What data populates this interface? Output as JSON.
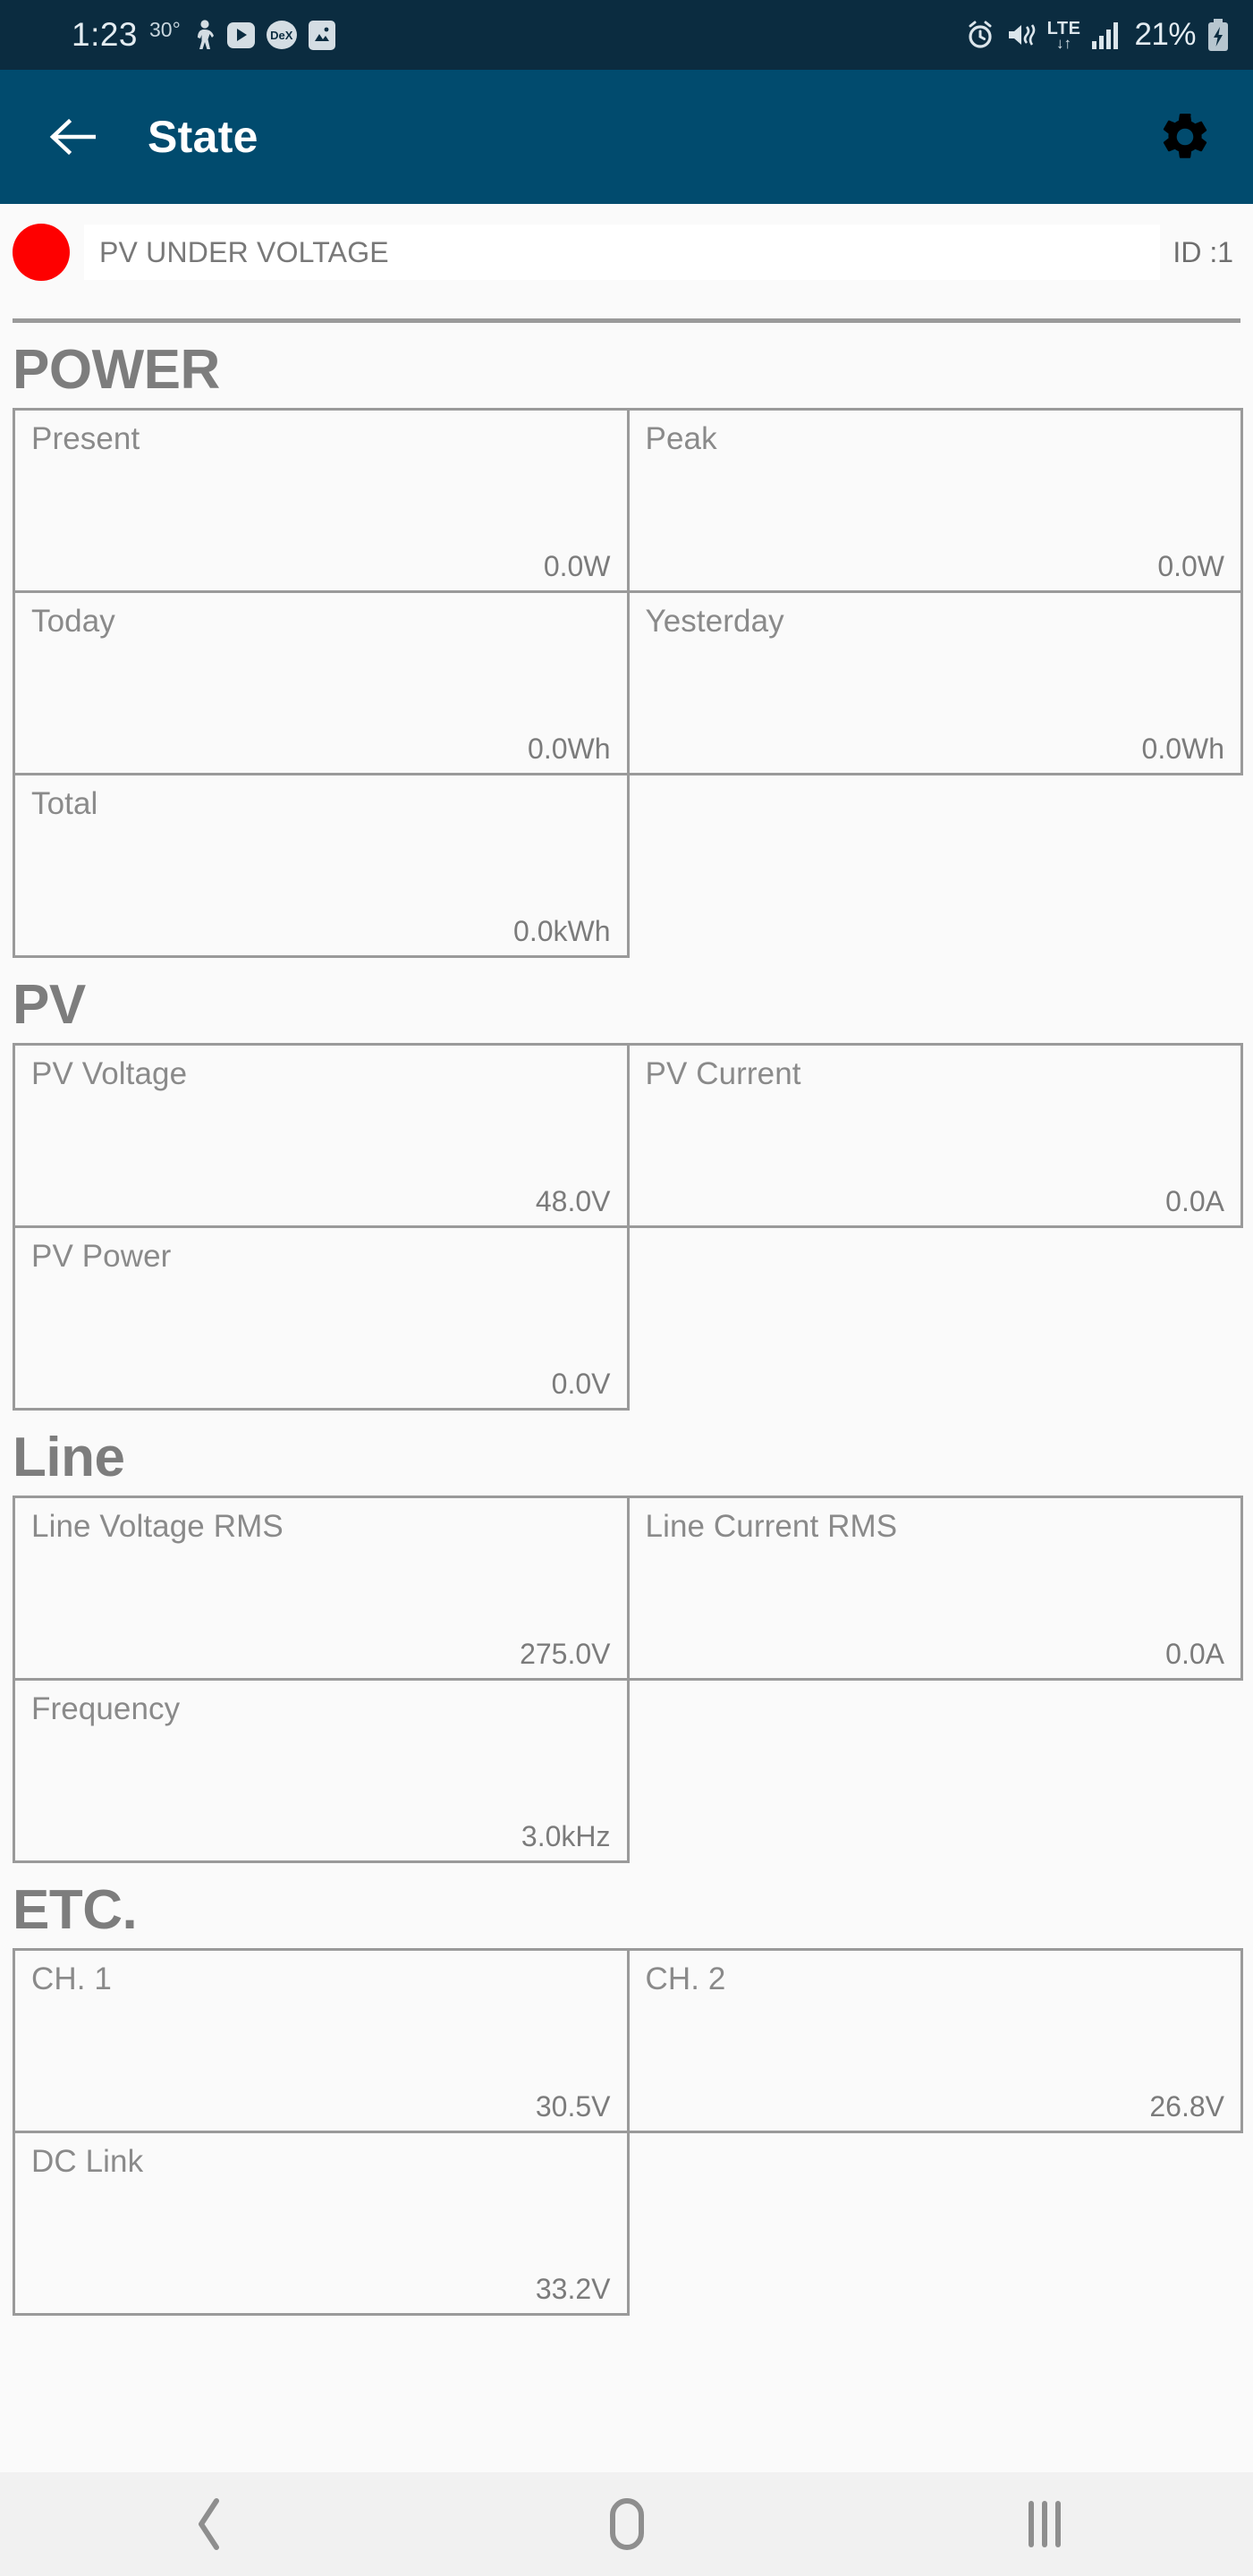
{
  "status_bar": {
    "time": "1:23",
    "temperature": "30°",
    "dex_label": "DeX",
    "network_type": "LTE",
    "network_arrows": "↓↑",
    "battery_percent": "21%",
    "icons": [
      "pedometer-icon",
      "youtube-icon",
      "dex-icon",
      "gallery-icon",
      "alarm-icon",
      "mute-icon",
      "lte-icon",
      "signal-icon",
      "battery-charging-icon"
    ]
  },
  "app_bar": {
    "title": "State",
    "back_icon": "arrow-left-icon",
    "settings_icon": "gear-icon",
    "background_color": "#014b6e"
  },
  "alert": {
    "status_color": "#fe0000",
    "message": "PV UNDER VOLTAGE",
    "id_label": "ID :1"
  },
  "sections": [
    {
      "title": "POWER",
      "rows": [
        [
          {
            "label": "Present",
            "value": "0.0W"
          },
          {
            "label": "Peak",
            "value": "0.0W"
          }
        ],
        [
          {
            "label": "Today",
            "value": "0.0Wh"
          },
          {
            "label": "Yesterday",
            "value": "0.0Wh"
          }
        ],
        [
          {
            "label": "Total",
            "value": "0.0kWh"
          },
          null
        ]
      ]
    },
    {
      "title": "PV",
      "rows": [
        [
          {
            "label": "PV Voltage",
            "value": "48.0V"
          },
          {
            "label": "PV Current",
            "value": "0.0A"
          }
        ],
        [
          {
            "label": "PV Power",
            "value": "0.0V"
          },
          null
        ]
      ]
    },
    {
      "title": "Line",
      "rows": [
        [
          {
            "label": "Line Voltage RMS",
            "value": "275.0V"
          },
          {
            "label": "Line Current RMS",
            "value": "0.0A"
          }
        ],
        [
          {
            "label": "Frequency",
            "value": "3.0kHz"
          },
          null
        ]
      ]
    },
    {
      "title": "ETC.",
      "rows": [
        [
          {
            "label": "CH. 1",
            "value": "30.5V"
          },
          {
            "label": "CH. 2",
            "value": "26.8V"
          }
        ],
        [
          {
            "label": "DC Link",
            "value": "33.2V"
          },
          null
        ]
      ]
    }
  ],
  "nav_bar": {
    "back_icon": "chevron-left-icon",
    "home_icon": "home-circle-icon",
    "recents_icon": "recents-bars-icon"
  }
}
